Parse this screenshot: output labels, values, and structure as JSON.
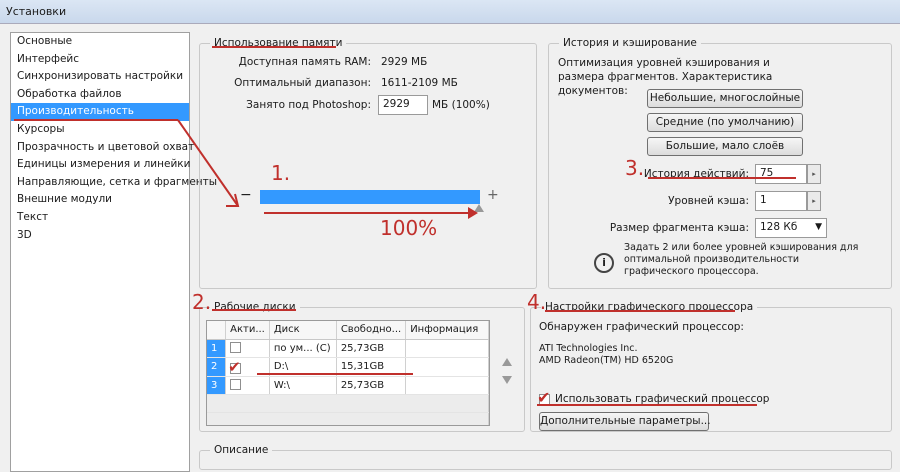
{
  "window": {
    "title": "Установки"
  },
  "sidebar": {
    "items": [
      {
        "label": "Основные"
      },
      {
        "label": "Интерфейс"
      },
      {
        "label": "Синхронизировать настройки"
      },
      {
        "label": "Обработка файлов"
      },
      {
        "label": "Производительность"
      },
      {
        "label": "Курсоры"
      },
      {
        "label": "Прозрачность и цветовой охват"
      },
      {
        "label": "Единицы измерения и линейки"
      },
      {
        "label": "Направляющие, сетка и фрагменты"
      },
      {
        "label": "Внешние модули"
      },
      {
        "label": "Текст"
      },
      {
        "label": "3D"
      }
    ],
    "active_index": 4
  },
  "memory": {
    "title": "Использование памяти",
    "available_label": "Доступная память RAM:",
    "available_value": "2929 МБ",
    "optimal_label": "Оптимальный диапазон:",
    "optimal_value": "1611-2109 МБ",
    "used_label": "Занято под Photoshop:",
    "used_value": "2929",
    "used_unit": "МБ (100%)",
    "slider_minus": "−",
    "slider_plus": "+",
    "slider_fraction": 1.0
  },
  "history": {
    "title": "История и кэширование",
    "desc": "Оптимизация уровней кэширования и размера фрагментов. Характеристика документов:",
    "btn_small": "Небольшие, многослойные",
    "btn_medium": "Средние (по умолчанию)",
    "btn_large": "Большие, мало слоёв",
    "history_label": "История действий:",
    "history_value": "75",
    "cache_levels_label": "Уровней кэша:",
    "cache_levels_value": "1",
    "tile_size_label": "Размер фрагмента кэша:",
    "tile_size_value": "128 Кб",
    "info_text": "Задать 2 или более уровней кэширования для оптимальной производительности графического процессора."
  },
  "scratch": {
    "title": "Рабочие диски",
    "headers": [
      "Акти...",
      "Диск",
      "Свободно...",
      "Информация"
    ],
    "rows": [
      {
        "num": "1",
        "checked": false,
        "disk": "по ум... (C)",
        "free": "25,73GB",
        "info": ""
      },
      {
        "num": "2",
        "checked": true,
        "disk": "D:\\",
        "free": "15,31GB",
        "info": ""
      },
      {
        "num": "3",
        "checked": false,
        "disk": "W:\\",
        "free": "25,73GB",
        "info": ""
      }
    ]
  },
  "gpu": {
    "title": "Настройки графического процессора",
    "detected_label": "Обнаружен графический процессор:",
    "vendor": "ATI Technologies Inc.",
    "model": "AMD Radeon(TM) HD 6520G",
    "use_gpu_label": "Использовать графический процессор",
    "use_gpu_checked": true,
    "advanced_btn": "Дополнительные параметры..."
  },
  "description": {
    "title": "Описание"
  },
  "annotations": {
    "n1": "1.",
    "n2": "2.",
    "n3": "3.",
    "n4": "4.",
    "percent": "100%",
    "color": "#c0302c"
  },
  "colors": {
    "accent": "#3399ff"
  }
}
